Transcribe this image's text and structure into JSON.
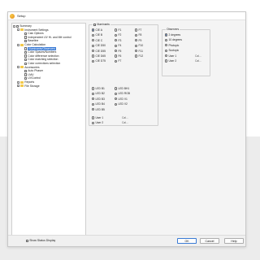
{
  "window": {
    "title": "Setup"
  },
  "tree": {
    "items": [
      {
        "label": "Summary",
        "level": 0,
        "toggle": "-",
        "kind": "doc"
      },
      {
        "label": "Instrument Settings",
        "level": 1,
        "toggle": "-",
        "kind": "folder"
      },
      {
        "label": "Calc Options",
        "level": 2,
        "toggle": "",
        "kind": "doc"
      },
      {
        "label": "Independent UV Hi- and Mfr control",
        "level": 2,
        "toggle": "",
        "kind": "doc"
      },
      {
        "label": "Baseline",
        "level": 2,
        "toggle": "",
        "kind": "doc"
      },
      {
        "label": "Color Calculation",
        "level": 1,
        "toggle": "-",
        "kind": "folder"
      },
      {
        "label": "Illuminants/Observers",
        "level": 2,
        "toggle": "",
        "kind": "doc",
        "selected": true
      },
      {
        "label": "Color Spaces/Numbers",
        "level": 2,
        "toggle": "",
        "kind": "doc"
      },
      {
        "label": "Color difference selection",
        "level": 2,
        "toggle": "",
        "kind": "doc"
      },
      {
        "label": "Color matching selection",
        "level": 2,
        "toggle": "",
        "kind": "doc"
      },
      {
        "label": "Color corrections selection",
        "level": 2,
        "toggle": "",
        "kind": "doc"
      },
      {
        "label": "Accessories",
        "level": 1,
        "toggle": "-",
        "kind": "folder"
      },
      {
        "label": "Auto Phaser",
        "level": 2,
        "toggle": "",
        "kind": "doc"
      },
      {
        "label": "LMU",
        "level": 2,
        "toggle": "",
        "kind": "doc"
      },
      {
        "label": "UVControl",
        "level": 2,
        "toggle": "",
        "kind": "doc"
      },
      {
        "label": "Reports",
        "level": 1,
        "toggle": "+",
        "kind": "folder"
      },
      {
        "label": "File Storage",
        "level": 1,
        "toggle": "+",
        "kind": "folder"
      }
    ]
  },
  "illuminants": {
    "title": "Illuminants",
    "col1": [
      {
        "label": "CIE A",
        "checked": true
      },
      {
        "label": "CIE B",
        "checked": false
      },
      {
        "label": "CIE C",
        "checked": false
      },
      {
        "label": "CIE D50",
        "checked": false
      },
      {
        "label": "CIE D55",
        "checked": false
      },
      {
        "label": "CIE D65",
        "checked": false
      },
      {
        "label": "CIE D75",
        "checked": false
      }
    ],
    "col2": [
      "F1",
      "F2",
      "F3",
      "F4",
      "F5",
      "F6",
      "F7"
    ],
    "col3": [
      "F7",
      "F8",
      "F9",
      "F10",
      "F11",
      "F12"
    ],
    "led1": [
      "LED B1",
      "LED B2",
      "LED B3",
      "LED B4",
      "LED B5"
    ],
    "led2": [
      "LED BH1",
      "LED RGB",
      "LED V1",
      "LED V2"
    ],
    "users": [
      {
        "label": "User 1",
        "browse": "Cal..."
      },
      {
        "label": "User 2",
        "browse": "Cal..."
      }
    ]
  },
  "observers": {
    "title": "Observers",
    "options": [
      {
        "label": "2 degrees",
        "checked": true
      },
      {
        "label": "10 degrees",
        "checked": false
      },
      {
        "label": "Photopic",
        "checked": false
      },
      {
        "label": "Scotopic",
        "checked": false
      },
      {
        "label": "User 1",
        "checked": false,
        "browse": "Cal..."
      },
      {
        "label": "User 2",
        "checked": false,
        "browse": "Cal..."
      }
    ]
  },
  "footer": {
    "show_status": "Show Status Display",
    "ok": "OK",
    "cancel": "Cancel",
    "help": "Help"
  }
}
